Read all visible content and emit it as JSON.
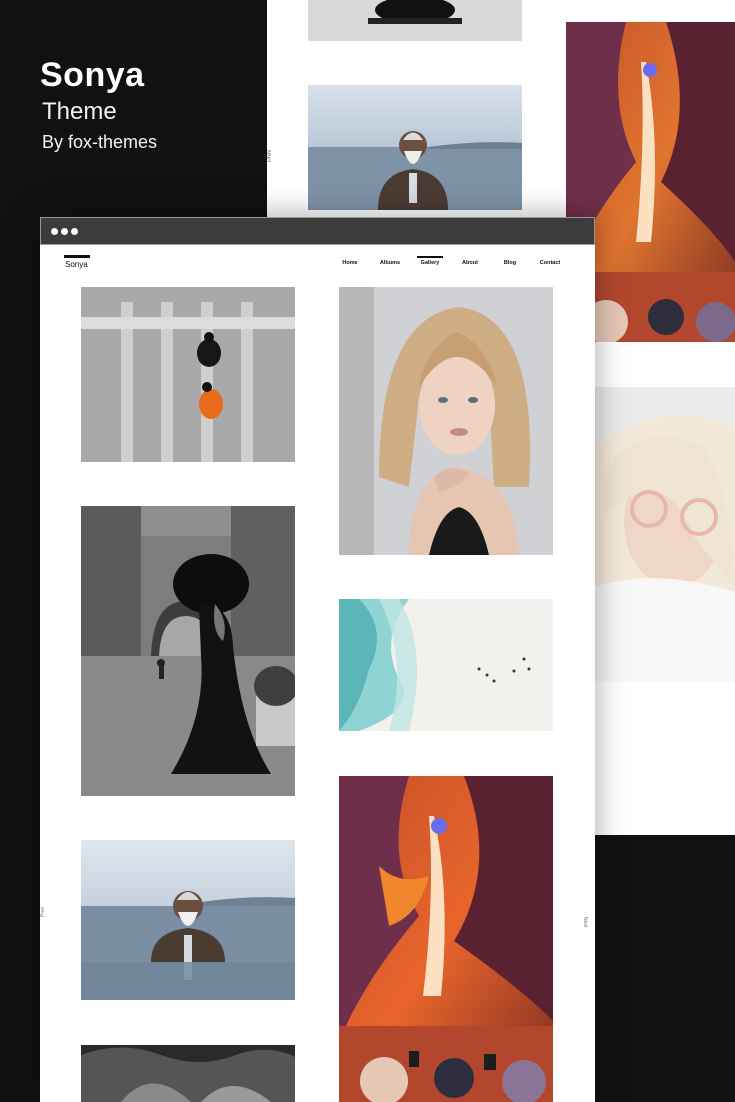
{
  "hero": {
    "title": "Sonya",
    "subtitle": "Theme",
    "byline": "By fox-themes"
  },
  "browser": {
    "site_logo": "Sonya",
    "nav": [
      {
        "label": "Home",
        "active": false
      },
      {
        "label": "Albums",
        "active": false
      },
      {
        "label": "Gallery",
        "active": true
      },
      {
        "label": "About",
        "active": false
      },
      {
        "label": "Blog",
        "active": false
      },
      {
        "label": "Contact",
        "active": false
      }
    ],
    "prev_label": "Prev",
    "next_label": "Next"
  },
  "background_screen": {
    "prev_label": "Prev"
  },
  "gallery": [
    {
      "name": "street-crosswalk-photo"
    },
    {
      "name": "blonde-woman-portrait-photo"
    },
    {
      "name": "black-gown-woman-photo"
    },
    {
      "name": "beach-aerial-photo"
    },
    {
      "name": "old-man-water-photo"
    },
    {
      "name": "antelope-canyon-photo"
    },
    {
      "name": "palm-leaves-photo"
    }
  ],
  "colors": {
    "page_bg": "#111111",
    "browser_bar": "#3c3c3c",
    "canyon_orange": "#e8642b"
  }
}
